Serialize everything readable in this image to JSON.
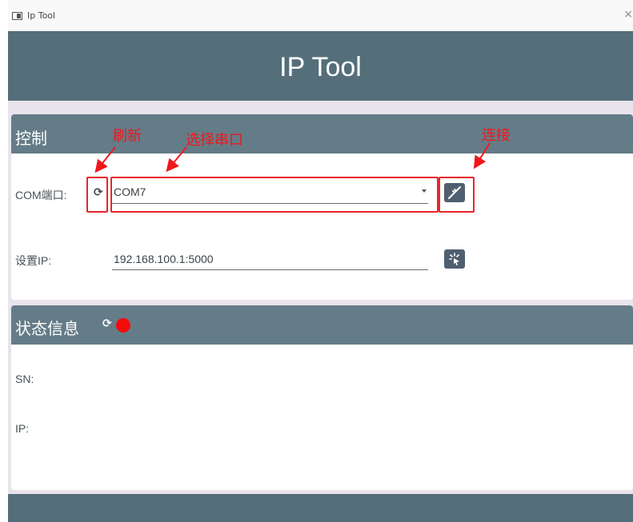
{
  "window": {
    "title": "Ip Tool",
    "close_glyph": "×"
  },
  "header": {
    "title": "IP Tool"
  },
  "control": {
    "title": "控制",
    "com_label": "COM端口:",
    "com_value": "COM7",
    "ip_label": "设置IP:",
    "ip_value": "192.168.100.1:5000",
    "icons": {
      "refresh": "refresh-icon",
      "connect": "plug-icon",
      "apply": "sparkle-click-icon",
      "dropdown": "chevron-down-icon"
    }
  },
  "status": {
    "title": "状态信息",
    "sn_label": "SN:",
    "ip_label": "IP:",
    "indicator_color": "#f40c0c",
    "icons": {
      "refresh": "refresh-icon"
    }
  },
  "annotations": {
    "refresh": "刷新",
    "select_port": "选择串口",
    "connect": "连接",
    "color": "#f0171c"
  },
  "theme": {
    "header_bg": "#546e7a",
    "section_bg": "#647c87",
    "button_bg": "#4f5f70"
  }
}
